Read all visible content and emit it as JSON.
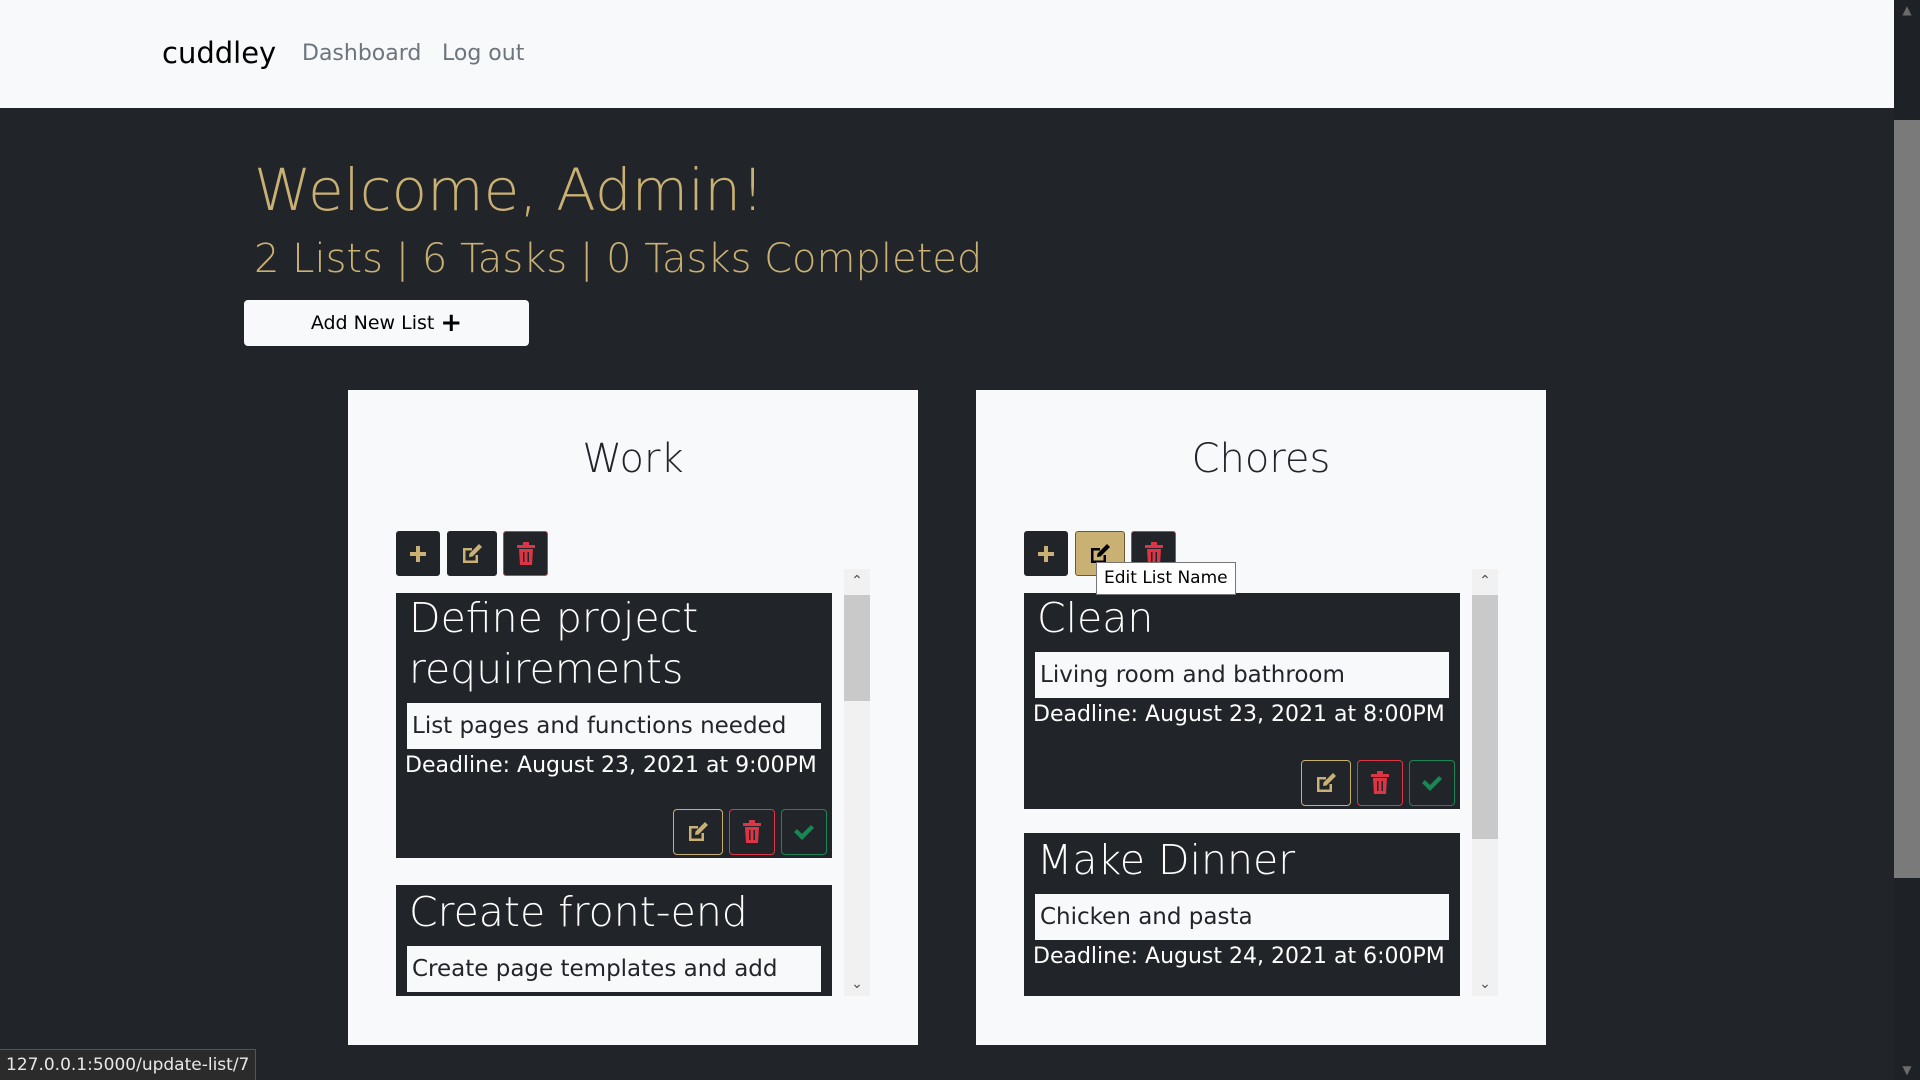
{
  "navbar": {
    "brand": "cuddley",
    "links": [
      "Dashboard",
      "Log out"
    ]
  },
  "header": {
    "welcome": "Welcome, Admin!",
    "stats": "2 Lists | 6 Tasks | 0 Tasks Completed",
    "add_list_label": "Add New List"
  },
  "colors": {
    "accent": "#c9b073",
    "danger": "#dc3545",
    "success": "#198754",
    "dark": "#212529",
    "light": "#f8f9fa"
  },
  "lists": [
    {
      "name": "Work",
      "buttons": [
        {
          "icon": "plus-icon"
        },
        {
          "icon": "edit-icon"
        },
        {
          "icon": "trash-icon"
        }
      ],
      "tasks": [
        {
          "title": "Define project requirements",
          "description": "List pages and functions needed",
          "deadline": "Deadline: August 23, 2021 at 9:00PM"
        },
        {
          "title": "Create front-end",
          "description": "Create page templates and add",
          "deadline": ""
        }
      ]
    },
    {
      "name": "Chores",
      "buttons": [
        {
          "icon": "plus-icon"
        },
        {
          "icon": "edit-icon"
        },
        {
          "icon": "trash-icon"
        }
      ],
      "tasks": [
        {
          "title": "Clean",
          "description": "Living room and bathroom",
          "deadline": "Deadline: August 23, 2021 at 8:00PM"
        },
        {
          "title": "Make Dinner",
          "description": "Chicken and pasta",
          "deadline": "Deadline: August 24, 2021 at 6:00PM"
        }
      ]
    }
  ],
  "tooltip": "Edit List Name",
  "status_bar": "127.0.0.1:5000/update-list/7"
}
